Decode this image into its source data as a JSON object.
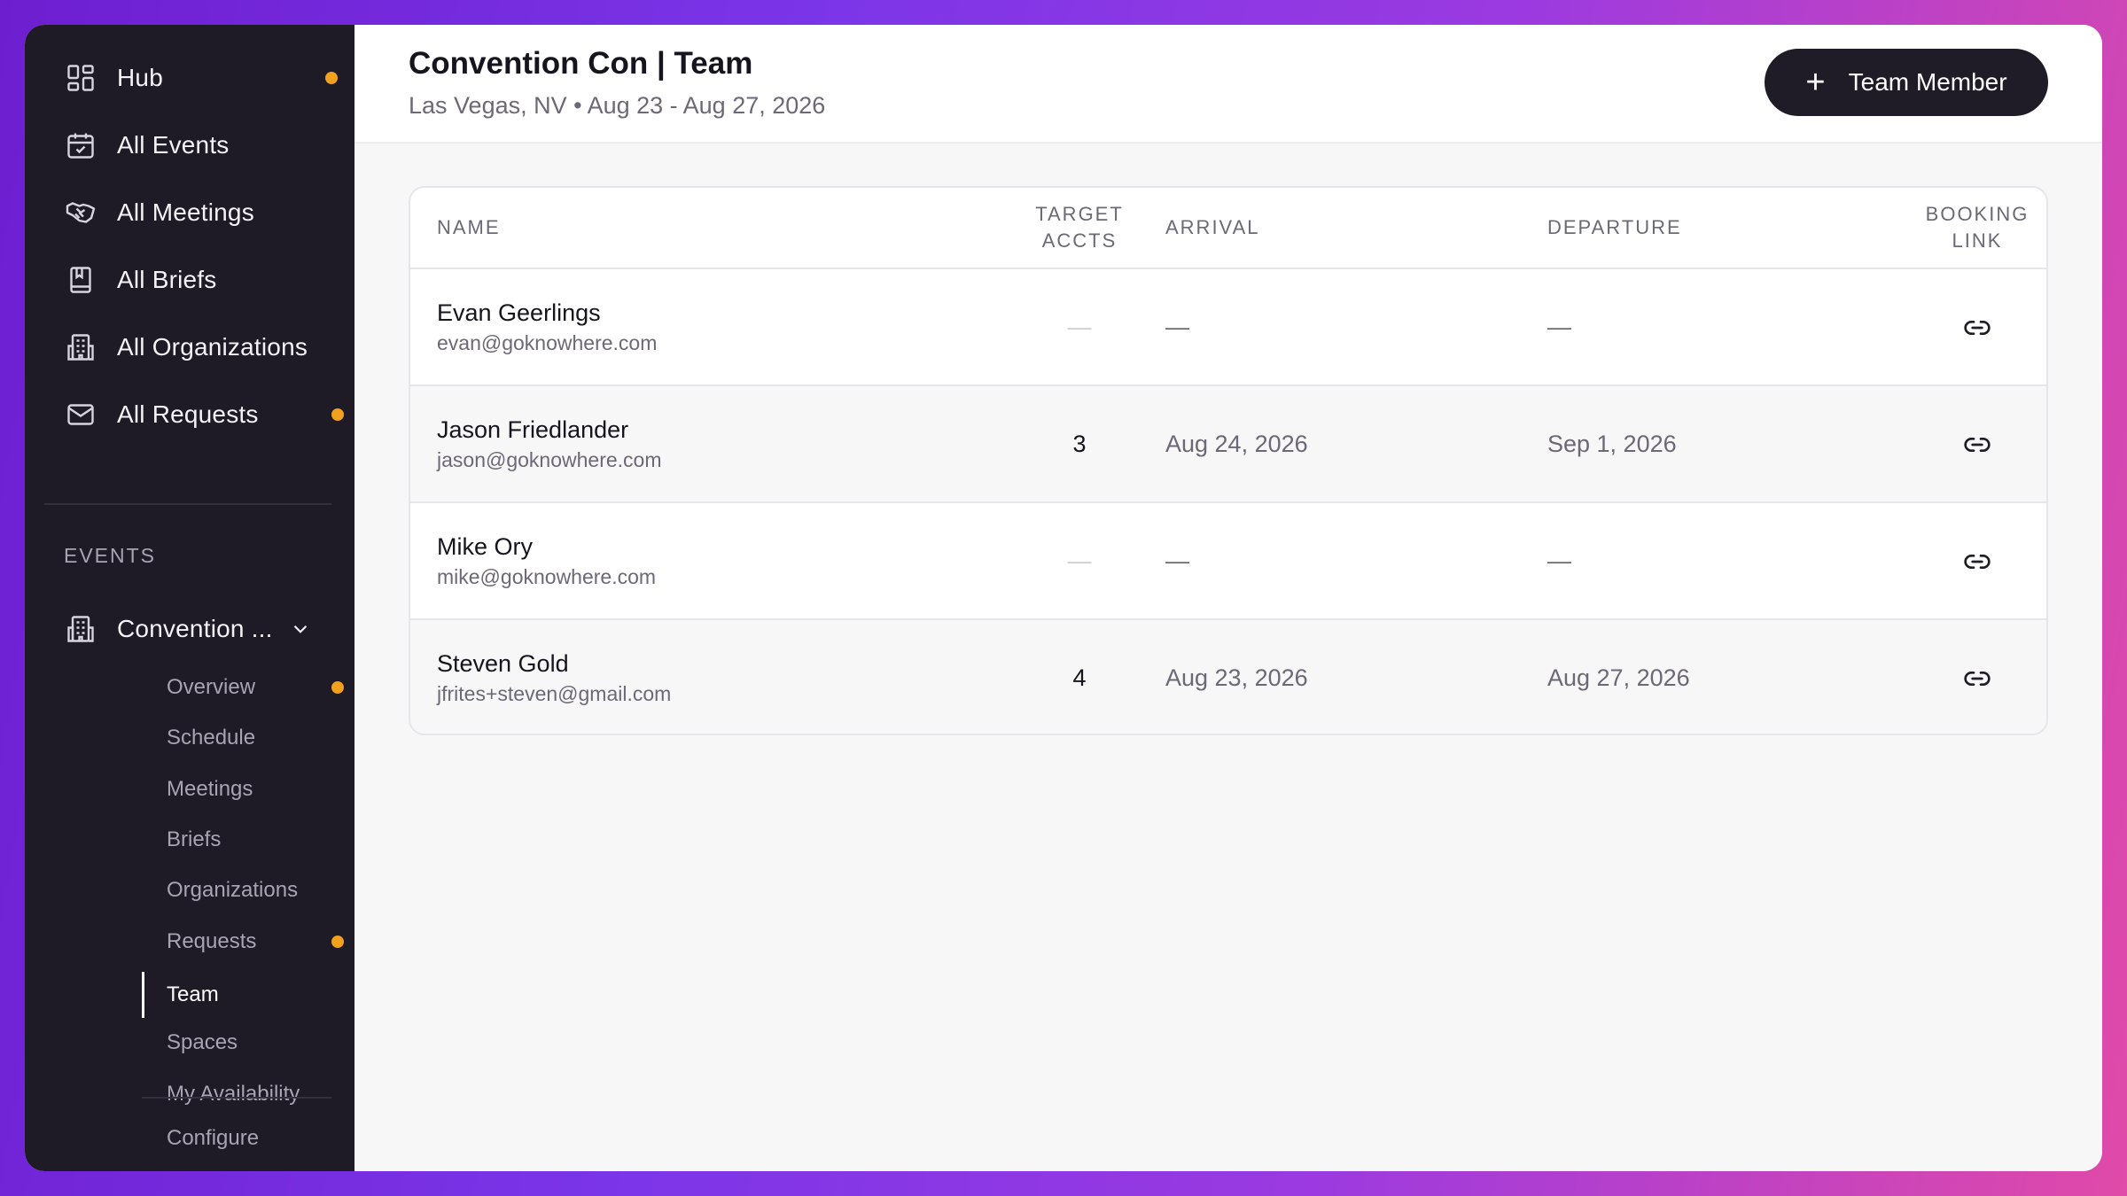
{
  "sidebar": {
    "nav": [
      {
        "label": "Hub",
        "icon": "grid-icon",
        "badge": true
      },
      {
        "label": "All Events",
        "icon": "calendar-check-icon",
        "badge": false
      },
      {
        "label": "All Meetings",
        "icon": "handshake-icon",
        "badge": false
      },
      {
        "label": "All Briefs",
        "icon": "book-icon",
        "badge": false
      },
      {
        "label": "All Organizations",
        "icon": "building-icon",
        "badge": false
      },
      {
        "label": "All Requests",
        "icon": "mail-icon",
        "badge": true
      }
    ],
    "section_label": "EVENTS",
    "event_selector": {
      "label": "Convention ...",
      "icon": "building-icon"
    },
    "sub_items": [
      {
        "label": "Overview",
        "badge": true
      },
      {
        "label": "Schedule",
        "badge": false
      },
      {
        "label": "Meetings",
        "badge": false
      },
      {
        "label": "Briefs",
        "badge": false
      },
      {
        "label": "Organizations",
        "badge": false
      },
      {
        "label": "Requests",
        "badge": true
      },
      {
        "label": "Team",
        "badge": false,
        "active": true
      },
      {
        "label": "Spaces",
        "badge": false
      },
      {
        "label": "My Availability",
        "badge": false
      }
    ],
    "configure_label": "Configure"
  },
  "header": {
    "title": "Convention Con | Team",
    "subtitle": "Las Vegas, NV • Aug 23 - Aug 27, 2026",
    "add_button_label": "Team Member"
  },
  "table": {
    "columns": {
      "name": "NAME",
      "target_line1": "TARGET",
      "target_line2": "ACCTS",
      "arrival": "ARRIVAL",
      "departure": "DEPARTURE",
      "booking_line1": "BOOKING",
      "booking_line2": "LINK"
    },
    "rows": [
      {
        "name": "Evan Geerlings",
        "email": "evan@goknowhere.com",
        "target": "—",
        "arrival": "—",
        "departure": "—"
      },
      {
        "name": "Jason Friedlander",
        "email": "jason@goknowhere.com",
        "target": "3",
        "arrival": "Aug 24, 2026",
        "departure": "Sep 1, 2026"
      },
      {
        "name": "Mike Ory",
        "email": "mike@goknowhere.com",
        "target": "—",
        "arrival": "—",
        "departure": "—"
      },
      {
        "name": "Steven Gold",
        "email": "jfrites+steven@gmail.com",
        "target": "4",
        "arrival": "Aug 23, 2026",
        "departure": "Aug 27, 2026"
      }
    ]
  },
  "colors": {
    "sidebar_bg": "#1e1a26",
    "badge": "#f2a11f",
    "primary_button": "#1f1b27"
  }
}
